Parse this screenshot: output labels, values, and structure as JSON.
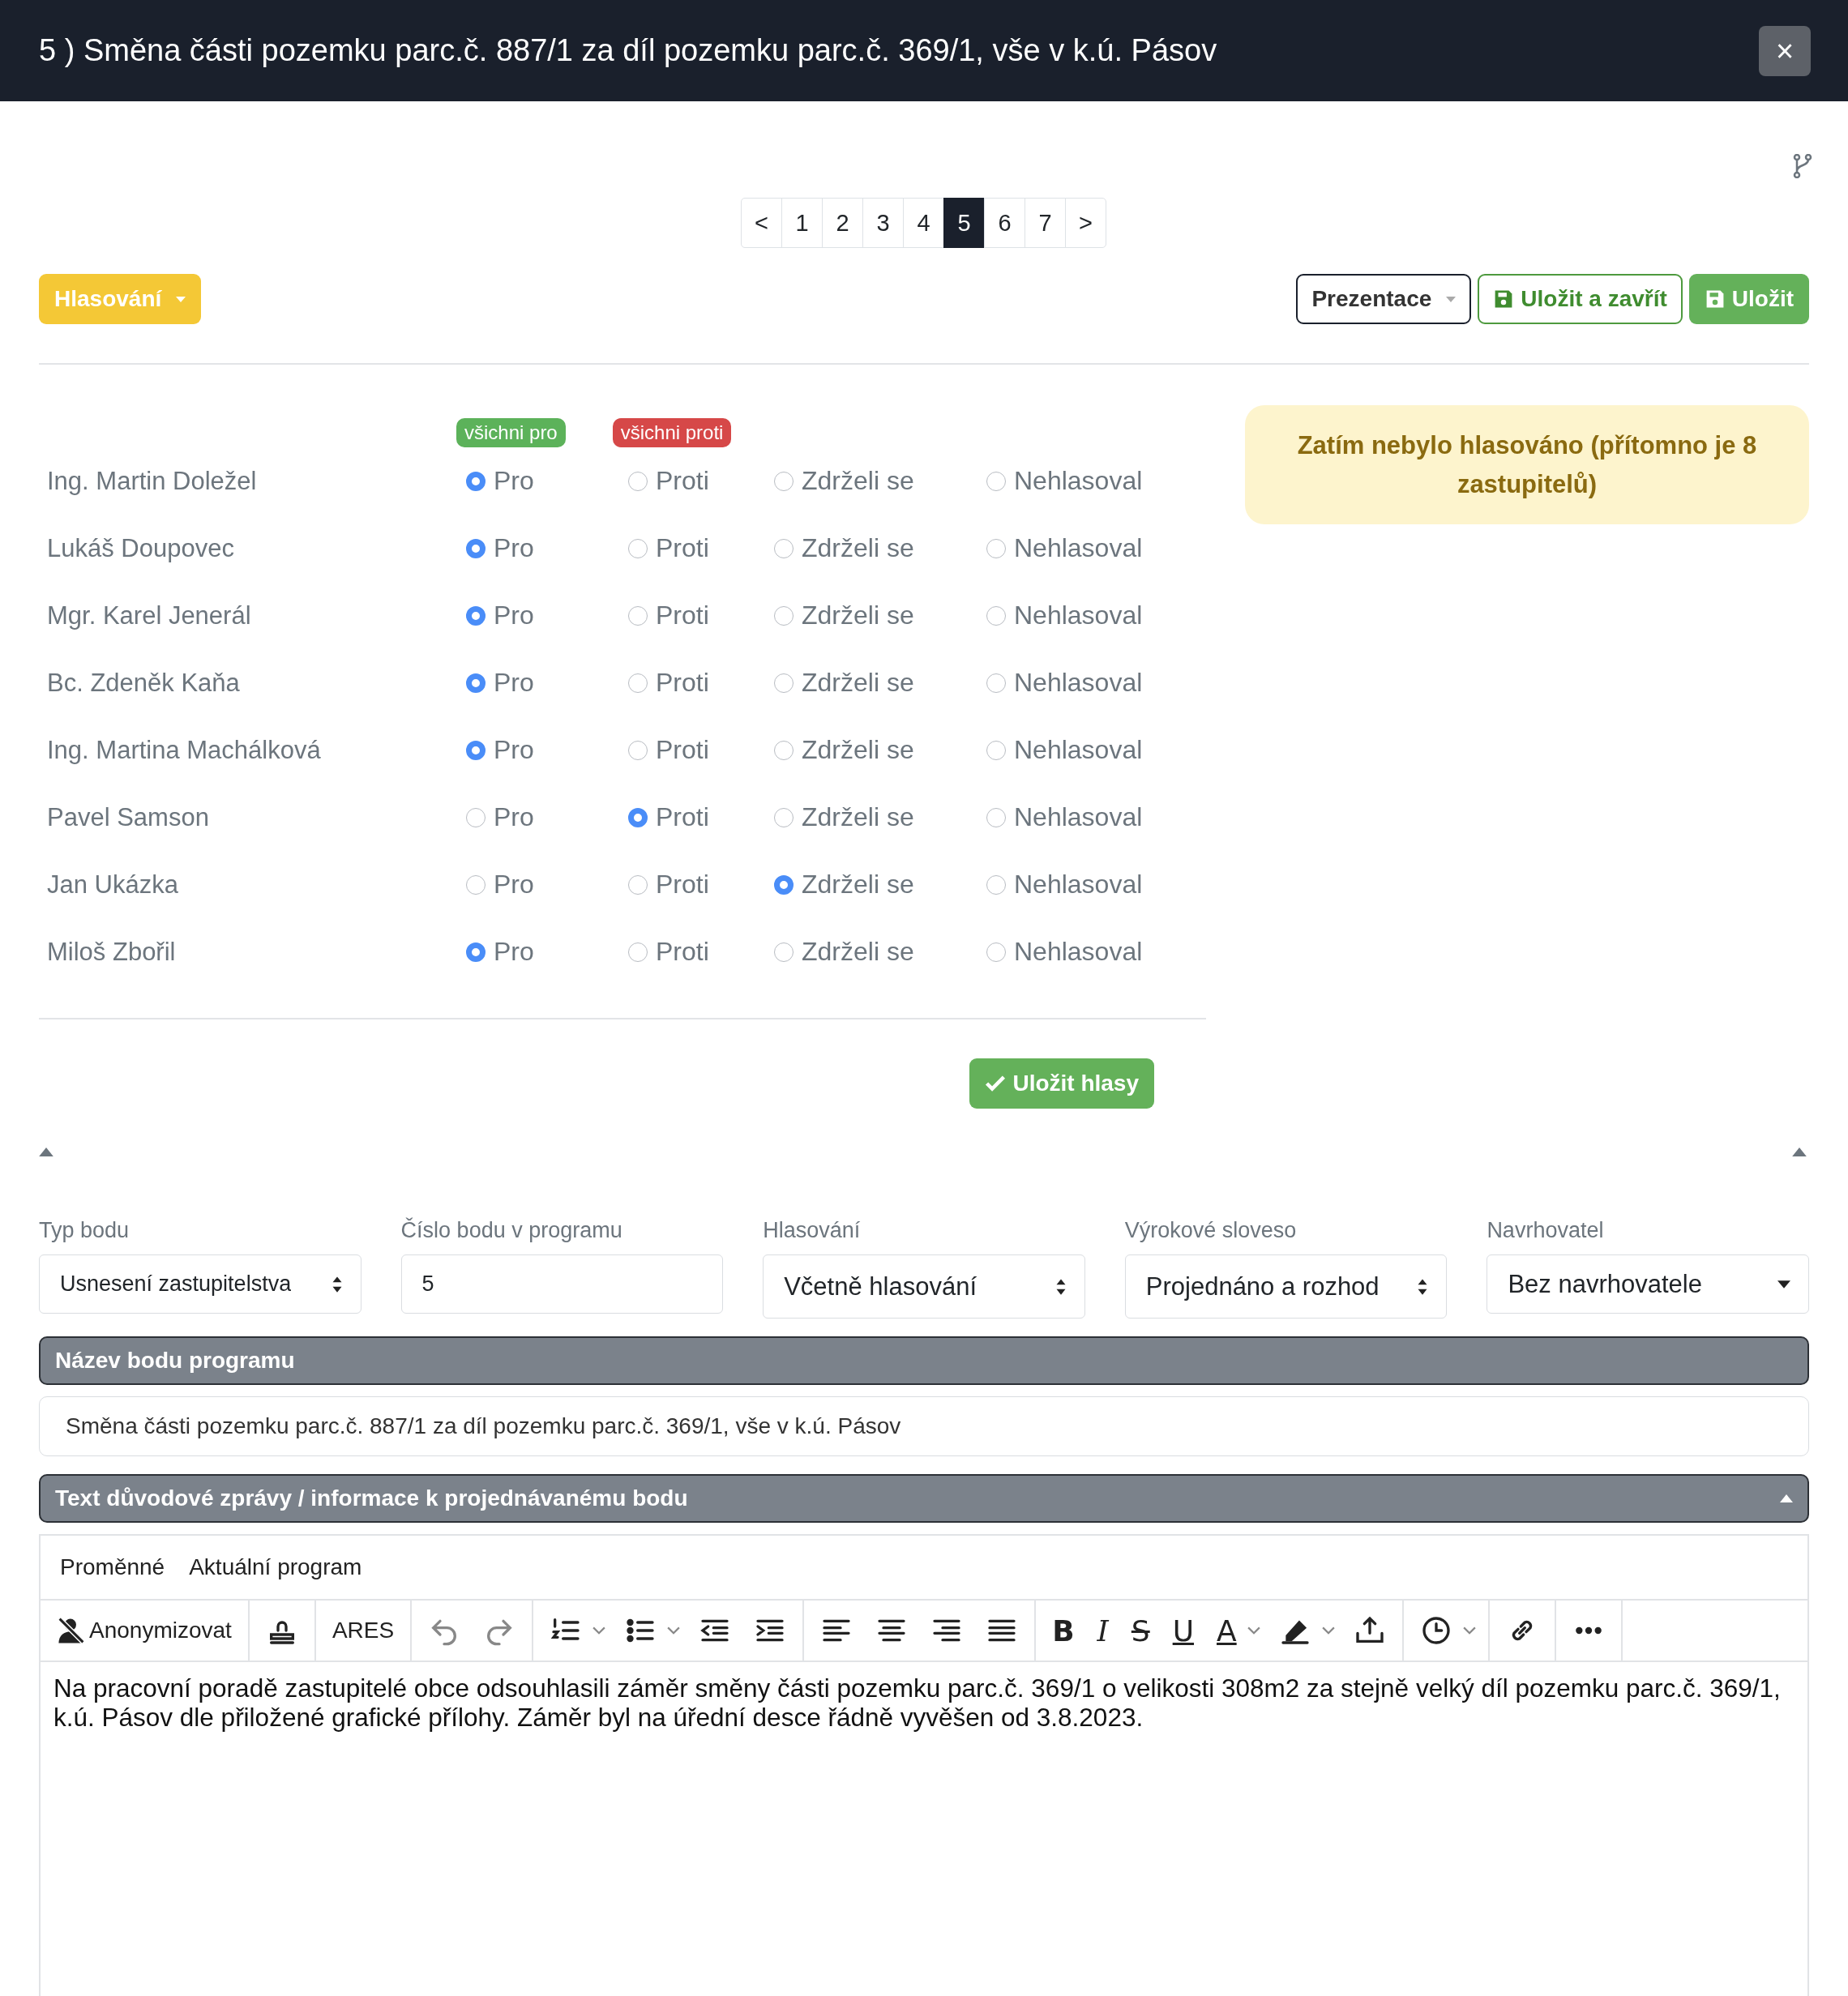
{
  "modal": {
    "title": "5 ) Směna části pozemku parc.č. 887/1 za díl pozemku parc.č. 369/1, vše v k.ú. Pásov",
    "close": "×"
  },
  "pagination": [
    {
      "label": "<",
      "selected": false
    },
    {
      "label": "1",
      "selected": false
    },
    {
      "label": "2",
      "selected": false
    },
    {
      "label": "3",
      "selected": false
    },
    {
      "label": "4",
      "selected": false
    },
    {
      "label": "5",
      "selected": true
    },
    {
      "label": "6",
      "selected": false
    },
    {
      "label": "7",
      "selected": false
    },
    {
      "label": ">",
      "selected": false
    }
  ],
  "mode_button": "Hlasování",
  "actions": [
    {
      "kind": "dropdown",
      "label": "Prezentace"
    },
    {
      "kind": "outline-save",
      "label": "Uložit a zavřít"
    },
    {
      "kind": "save",
      "label": "Uložit"
    }
  ],
  "bulk": [
    {
      "kind": "pro",
      "label": "všichni pro"
    },
    {
      "kind": "proti",
      "label": "všichni proti"
    }
  ],
  "members": [
    {
      "name": "Ing. Martin Doležel",
      "options": [
        {
          "label": "Pro",
          "selected": true
        },
        {
          "label": "Proti",
          "selected": false
        },
        {
          "label": "Zdrželi se",
          "selected": false
        },
        {
          "label": "Nehlasoval",
          "selected": false
        }
      ]
    },
    {
      "name": "Lukáš Doupovec",
      "options": [
        {
          "label": "Pro",
          "selected": true
        },
        {
          "label": "Proti",
          "selected": false
        },
        {
          "label": "Zdrželi se",
          "selected": false
        },
        {
          "label": "Nehlasoval",
          "selected": false
        }
      ]
    },
    {
      "name": "Mgr. Karel Jenerál",
      "options": [
        {
          "label": "Pro",
          "selected": true
        },
        {
          "label": "Proti",
          "selected": false
        },
        {
          "label": "Zdrželi se",
          "selected": false
        },
        {
          "label": "Nehlasoval",
          "selected": false
        }
      ]
    },
    {
      "name": "Bc. Zdeněk Kaňa",
      "options": [
        {
          "label": "Pro",
          "selected": true
        },
        {
          "label": "Proti",
          "selected": false
        },
        {
          "label": "Zdrželi se",
          "selected": false
        },
        {
          "label": "Nehlasoval",
          "selected": false
        }
      ]
    },
    {
      "name": "Ing. Martina Machálková",
      "options": [
        {
          "label": "Pro",
          "selected": true
        },
        {
          "label": "Proti",
          "selected": false
        },
        {
          "label": "Zdrželi se",
          "selected": false
        },
        {
          "label": "Nehlasoval",
          "selected": false
        }
      ]
    },
    {
      "name": "Pavel Samson",
      "options": [
        {
          "label": "Pro",
          "selected": false
        },
        {
          "label": "Proti",
          "selected": true
        },
        {
          "label": "Zdrželi se",
          "selected": false
        },
        {
          "label": "Nehlasoval",
          "selected": false
        }
      ]
    },
    {
      "name": "Jan Ukázka",
      "options": [
        {
          "label": "Pro",
          "selected": false
        },
        {
          "label": "Proti",
          "selected": false
        },
        {
          "label": "Zdrželi se",
          "selected": true
        },
        {
          "label": "Nehlasoval",
          "selected": false
        }
      ]
    },
    {
      "name": "Miloš Zbořil",
      "options": [
        {
          "label": "Pro",
          "selected": true
        },
        {
          "label": "Proti",
          "selected": false
        },
        {
          "label": "Zdrželi se",
          "selected": false
        },
        {
          "label": "Nehlasoval",
          "selected": false
        }
      ]
    }
  ],
  "vote_status": "Zatím nebylo hlasováno (přítomno je 8 zastupitelů)",
  "save_votes": "Uložit hlasy",
  "fields": [
    {
      "label": "Typ bodu",
      "kind": "updown",
      "value": "Usnesení zastupitelstva"
    },
    {
      "label": "Číslo bodu v programu",
      "kind": "input",
      "value": "5"
    },
    {
      "label": "Hlasování",
      "kind": "updown",
      "value": "Včetně hlasování"
    },
    {
      "label": "Výrokové sloveso",
      "kind": "updown",
      "value": "Projednáno a rozhod"
    },
    {
      "label": "Navrhovatel",
      "kind": "caret",
      "value": "Bez navrhovatele"
    }
  ],
  "name_section": {
    "title": "Název bodu programu",
    "value": "Směna části pozemku parc.č. 887/1 za díl pozemku parc.č. 369/1, vše v k.ú. Pásov"
  },
  "text_section": {
    "title": "Text důvodové zprávy / informace k projednávanému bodu",
    "expanded": true
  },
  "editor": {
    "menu": [
      "Proměnné",
      "Aktuální program"
    ],
    "toolbar": [
      [
        {
          "kind": "anonymize",
          "label": "Anonymizovat"
        }
      ],
      [
        {
          "kind": "stamp"
        }
      ],
      [
        {
          "kind": "text",
          "label": "ARES"
        }
      ],
      [
        {
          "kind": "undo"
        },
        {
          "kind": "redo"
        }
      ],
      [
        {
          "kind": "olist",
          "caret": true
        },
        {
          "kind": "ulist",
          "caret": true
        },
        {
          "kind": "outdent"
        },
        {
          "kind": "indent"
        }
      ],
      [
        {
          "kind": "alignleft"
        },
        {
          "kind": "aligncenter"
        },
        {
          "kind": "alignright"
        },
        {
          "kind": "justify"
        }
      ],
      [
        {
          "kind": "bold",
          "label": "B"
        },
        {
          "kind": "italic",
          "label": "I"
        },
        {
          "kind": "strike",
          "label": "S"
        },
        {
          "kind": "underline",
          "label": "U"
        },
        {
          "kind": "textcolor",
          "label": "A",
          "caret": true
        },
        {
          "kind": "highlight",
          "caret": true
        },
        {
          "kind": "insert"
        }
      ],
      [
        {
          "kind": "clock",
          "caret": true
        }
      ],
      [
        {
          "kind": "link"
        }
      ],
      [
        {
          "kind": "more"
        }
      ]
    ],
    "content": "Na pracovní poradě zastupitelé obce odsouhlasili záměr směny části pozemku parc.č. 369/1 o velikosti 308m2 za stejně velký díl pozemku parc.č. 369/1, k.ú. Pásov dle přiložené grafické přílohy. Záměr byl na úřední desce řádně vyvěšen od 3.8.2023."
  }
}
